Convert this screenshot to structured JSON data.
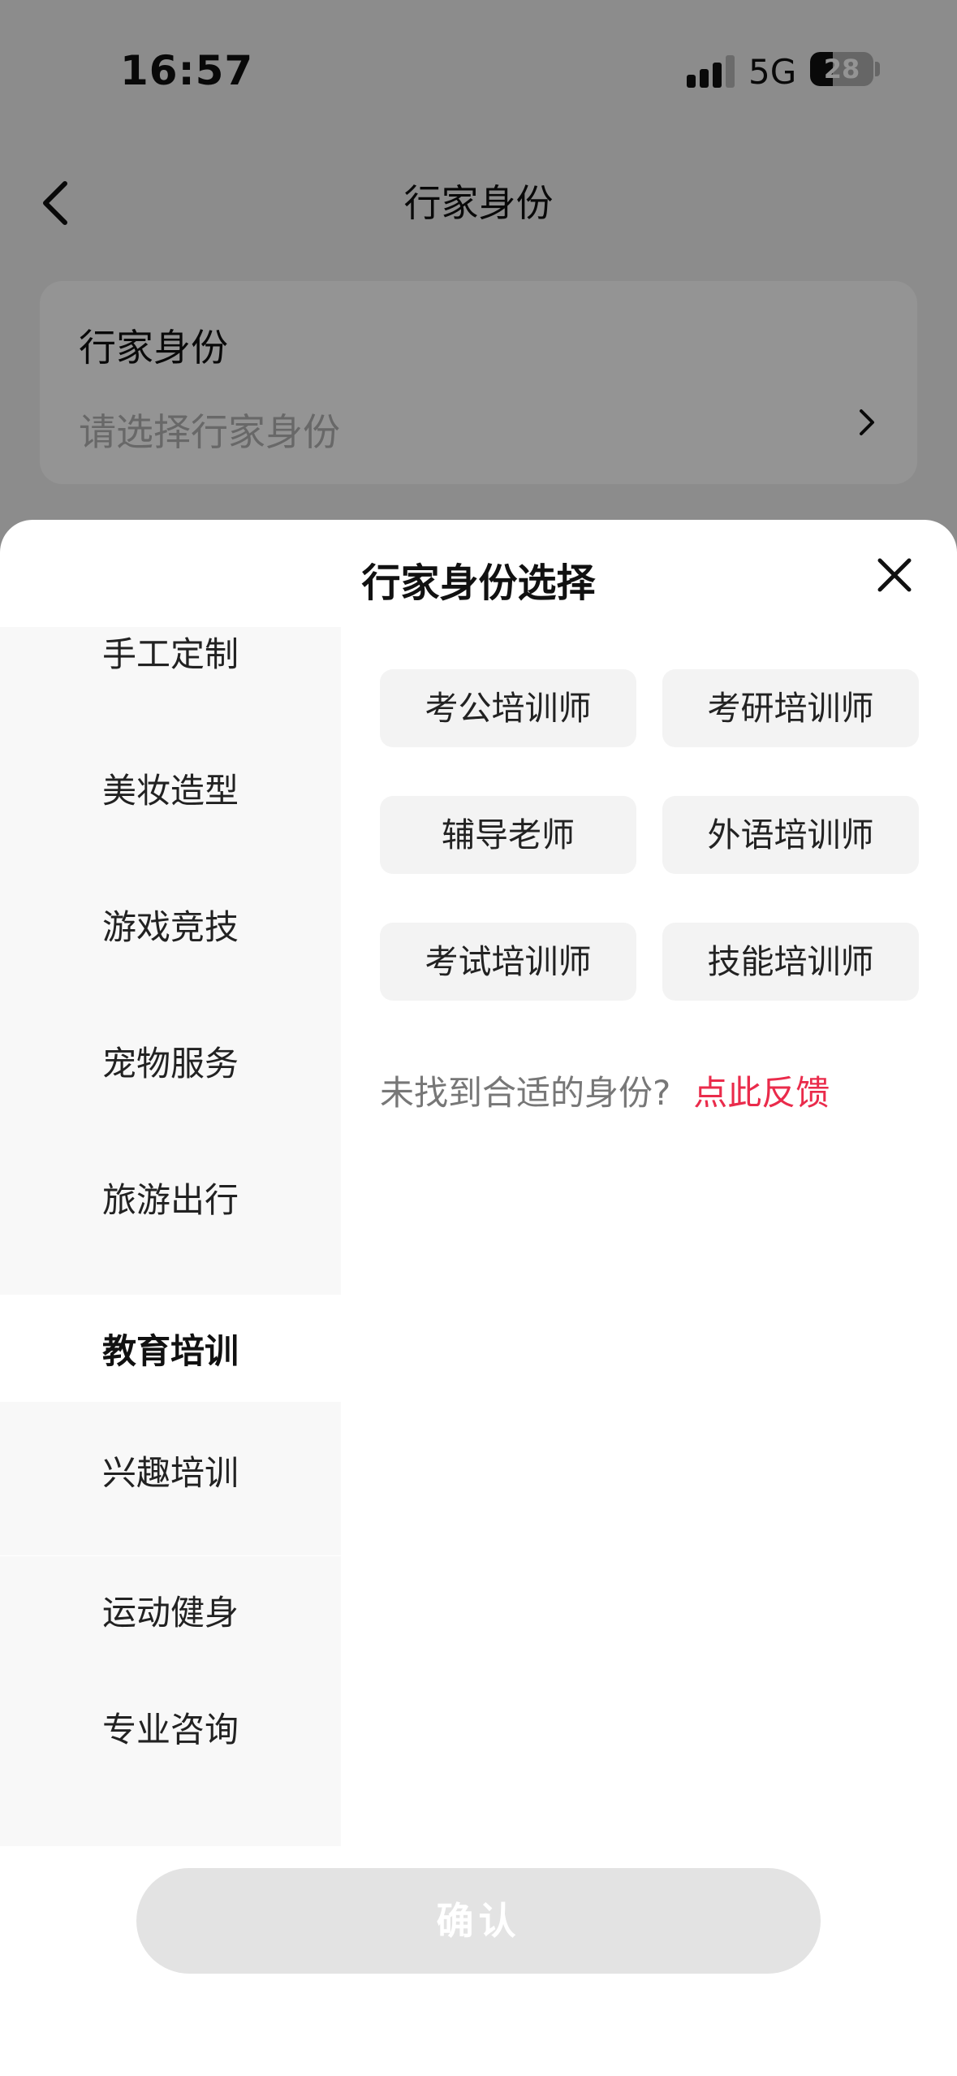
{
  "status_bar": {
    "time": "16:57",
    "network": "5G",
    "battery": "28"
  },
  "nav": {
    "title": "行家身份"
  },
  "identity_card": {
    "label": "行家身份",
    "placeholder": "请选择行家身份"
  },
  "sheet": {
    "title": "行家身份选择",
    "categories": [
      {
        "label": "手工定制",
        "active": false
      },
      {
        "label": "美妆造型",
        "active": false
      },
      {
        "label": "游戏竞技",
        "active": false
      },
      {
        "label": "宠物服务",
        "active": false
      },
      {
        "label": "旅游出行",
        "active": false
      },
      {
        "label": "教育培训",
        "active": true
      },
      {
        "label": "兴趣培训",
        "active": false
      },
      {
        "label": "运动健身",
        "active": false
      },
      {
        "label": "专业咨询",
        "active": false
      }
    ],
    "options": [
      "考公培训师",
      "考研培训师",
      "辅导老师",
      "外语培训师",
      "考试培训师",
      "技能培训师"
    ],
    "feedback": {
      "question": "未找到合适的身份?",
      "link": "点此反馈"
    },
    "confirm_label": "确认"
  },
  "colors": {
    "accent": "#ea2b4b",
    "chip_bg": "#f3f3f3",
    "sidebar_bg": "#f8f8f8",
    "confirm_disabled": "#e3e3e3"
  },
  "icons": [
    "chevron-left-icon",
    "chevron-right-icon",
    "close-icon",
    "signal-icon",
    "battery-icon"
  ]
}
